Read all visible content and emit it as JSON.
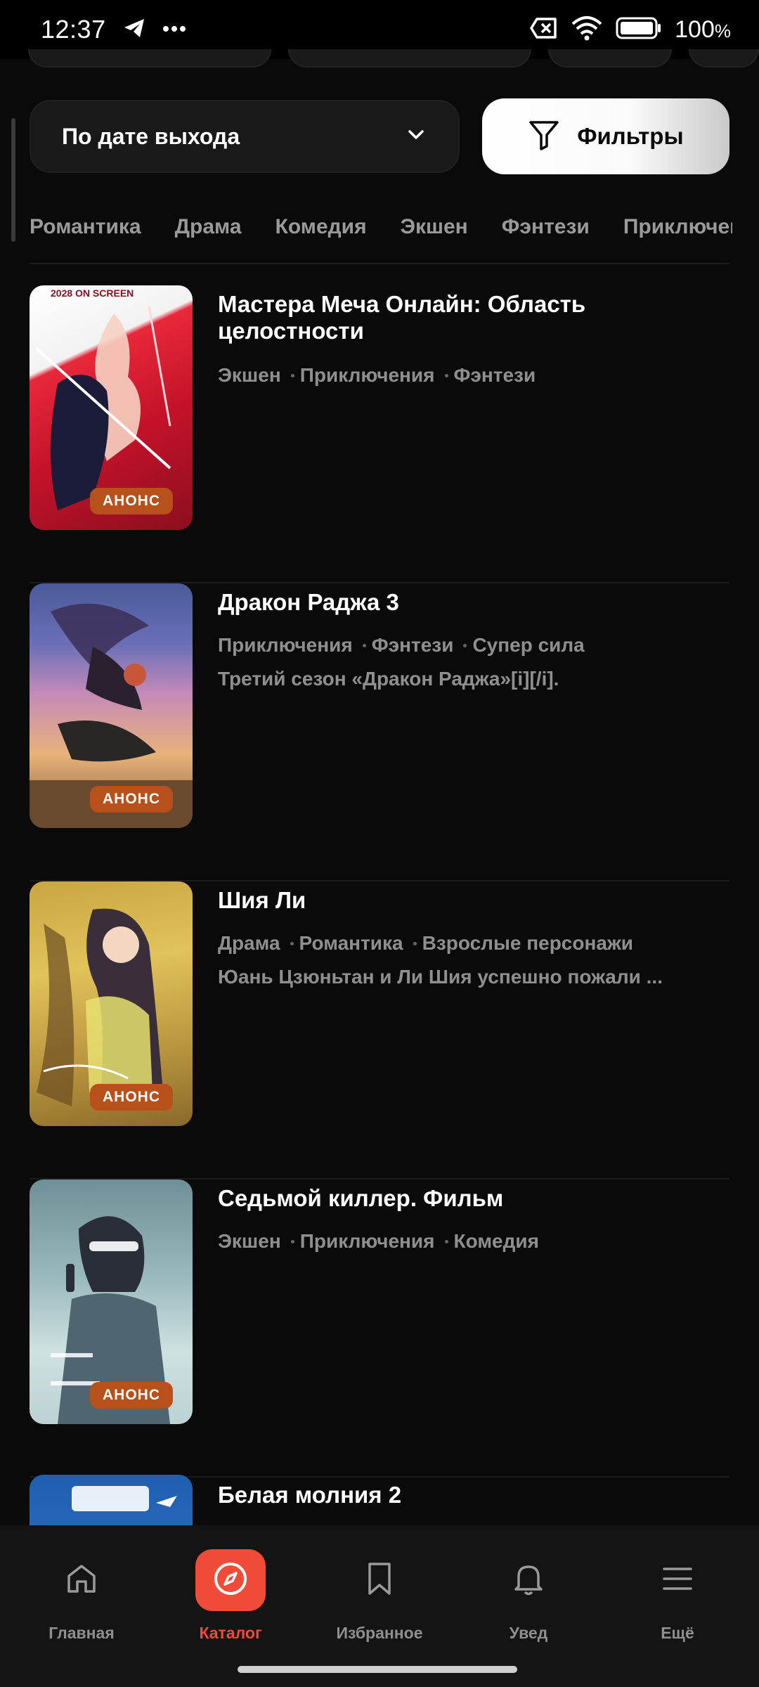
{
  "status_bar": {
    "time": "12:37",
    "battery": "100",
    "battery_unit": "%"
  },
  "sort": {
    "label": "По дате выхода"
  },
  "filter": {
    "label": "Фильтры"
  },
  "genre_tabs": [
    "Романтика",
    "Драма",
    "Комедия",
    "Экшен",
    "Фэнтези",
    "Приключения"
  ],
  "items": [
    {
      "title": "Мастера Меча Онлайн: Область целостности",
      "tags": [
        "Экшен",
        "Приключения",
        "Фэнтези"
      ],
      "description": "",
      "badge": "АНОНС",
      "poster_caption": "2028 ON SCREEN"
    },
    {
      "title": "Дракон Раджа 3",
      "tags": [
        "Приключения",
        "Фэнтези",
        "Супер сила"
      ],
      "description": "Третий сезон «Дракон Раджа»[i][/i].",
      "badge": "АНОНС"
    },
    {
      "title": "Шия Ли",
      "tags": [
        "Драма",
        "Романтика",
        "Взрослые персонажи"
      ],
      "description": "Юань Цзюньтан и Ли Шия успешно пожали ...",
      "badge": "АНОНС"
    },
    {
      "title": "Седьмой киллер. Фильм",
      "tags": [
        "Экшен",
        "Приключения",
        "Комедия"
      ],
      "description": "",
      "badge": "АНОНС"
    },
    {
      "title": "Белая молния 2"
    }
  ],
  "nav": {
    "items": [
      {
        "label": "Главная",
        "icon": "home-icon"
      },
      {
        "label": "Каталог",
        "icon": "compass-icon"
      },
      {
        "label": "Избранное",
        "icon": "bookmark-icon"
      },
      {
        "label": "Увед",
        "icon": "bell-icon"
      },
      {
        "label": "Ещё",
        "icon": "menu-icon"
      }
    ],
    "active_index": 1
  },
  "colors": {
    "accent": "#f04a38",
    "badge": "#b8501c",
    "background": "#0a0a0a"
  }
}
